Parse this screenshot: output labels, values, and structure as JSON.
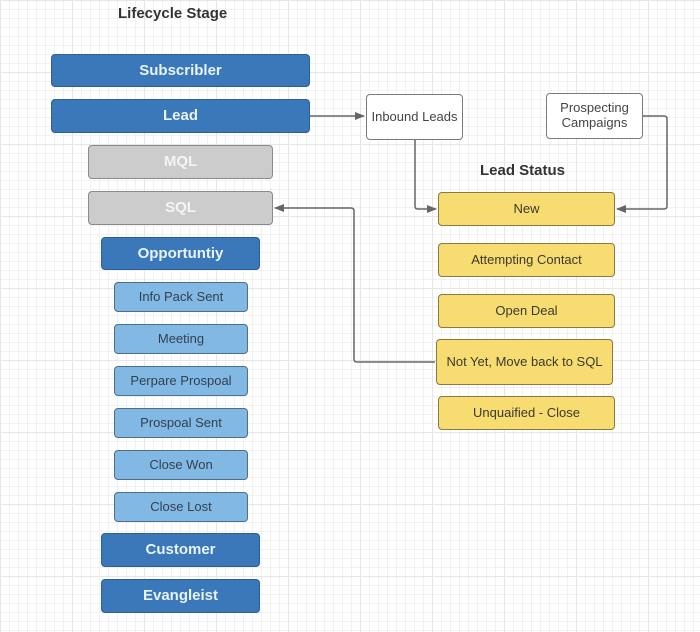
{
  "lifecycle": {
    "title": "Lifecycle Stage",
    "stages": [
      "Subscribler",
      "Lead",
      "MQL",
      "SQL",
      "Opportuntiy"
    ],
    "opportunity_substages": [
      "Info Pack Sent",
      "Meeting",
      "Perpare Prospoal",
      "Prospoal Sent",
      "Close Won",
      "Close Lost"
    ],
    "final_stages": [
      "Customer",
      "Evangleist"
    ]
  },
  "sources": {
    "inbound": "Inbound Leads",
    "prospecting": "Prospecting Campaigns"
  },
  "lead_status": {
    "title": "Lead Status",
    "items": [
      "New",
      "Attempting Contact",
      "Open Deal",
      "Not Yet, Move back to SQL",
      "Unquaified - Close"
    ]
  },
  "colors": {
    "stage_primary": "#3a78b9",
    "stage_inactive": "#cccccc",
    "substage": "#82b8e4",
    "status": "#f7dc72",
    "connector": "#666666"
  }
}
